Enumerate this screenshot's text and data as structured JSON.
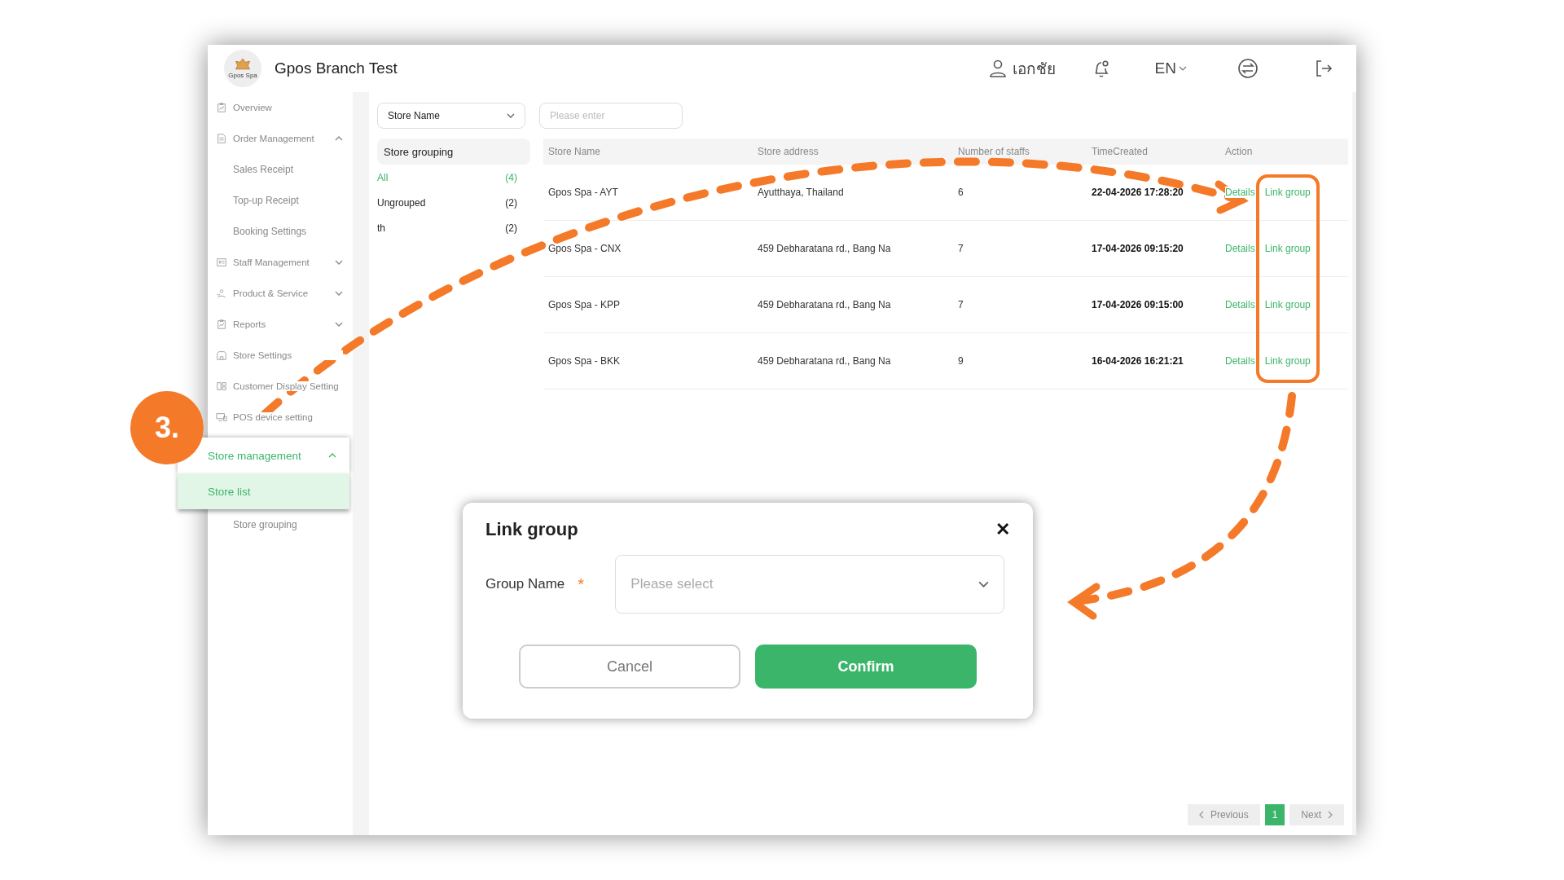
{
  "header": {
    "logo_text": "Gpos Spa",
    "title": "Gpos Branch Test",
    "user": "เอกชัย",
    "language": "EN"
  },
  "sidebar": {
    "items": [
      {
        "label": "Overview",
        "kind": "link",
        "selected": false
      },
      {
        "label": "Order Management",
        "kind": "group",
        "expanded": true,
        "selected": false,
        "children": [
          {
            "label": "Sales Receipt",
            "selected": false
          },
          {
            "label": "Top-up Receipt",
            "selected": false
          },
          {
            "label": "Booking Settings",
            "selected": false
          }
        ]
      },
      {
        "label": "Staff Management",
        "kind": "group",
        "expanded": false,
        "selected": false
      },
      {
        "label": "Product & Service",
        "kind": "group",
        "expanded": false,
        "selected": false
      },
      {
        "label": "Reports",
        "kind": "group",
        "expanded": false,
        "selected": false
      },
      {
        "label": "Store Settings",
        "kind": "link",
        "selected": false
      },
      {
        "label": "Customer Display Setting",
        "kind": "link",
        "selected": false
      },
      {
        "label": "POS device setting",
        "kind": "link",
        "selected": false
      },
      {
        "label": "Store management",
        "kind": "group",
        "expanded": true,
        "selected": true,
        "children": [
          {
            "label": "Store list",
            "selected": true
          },
          {
            "label": "Store grouping",
            "selected": false
          }
        ]
      }
    ]
  },
  "filters": {
    "field": "Store Name",
    "search_placeholder": "Please enter"
  },
  "store_grouping": {
    "title": "Store grouping",
    "items": [
      {
        "label": "All",
        "count": "(4)",
        "selected": true
      },
      {
        "label": "Ungrouped",
        "count": "(2)",
        "selected": false
      },
      {
        "label": "th",
        "count": "(2)",
        "selected": false
      }
    ]
  },
  "table": {
    "columns": [
      "Store Name",
      "Store address",
      "Number of staffs",
      "TimeCreated",
      "Action"
    ],
    "rows": [
      {
        "name": "Gpos Spa - AYT",
        "address": "Ayutthaya, Thailand",
        "staffs": "6",
        "created": "22-04-2026 17:28:20",
        "actions": [
          "Details",
          "Link group"
        ]
      },
      {
        "name": "Gpos Spa - CNX",
        "address": "459 Debharatana rd., Bang Na",
        "staffs": "7",
        "created": "17-04-2026 09:15:20",
        "actions": [
          "Details",
          "Link group"
        ]
      },
      {
        "name": "Gpos Spa - KPP",
        "address": "459 Debharatana rd., Bang Na",
        "staffs": "7",
        "created": "17-04-2026 09:15:00",
        "actions": [
          "Details",
          "Link group"
        ]
      },
      {
        "name": "Gpos Spa - BKK",
        "address": "459 Debharatana rd., Bang Na",
        "staffs": "9",
        "created": "16-04-2026 16:21:21",
        "actions": [
          "Details",
          "Link group"
        ]
      }
    ]
  },
  "pagination": {
    "previous": {
      "label": "Previous",
      "disabled": true
    },
    "pages": [
      {
        "label": "1",
        "selected": true
      }
    ],
    "next": {
      "label": "Next",
      "disabled": true
    }
  },
  "dialog": {
    "title": "Link group",
    "close": "✕",
    "field_label": "Group Name",
    "required_mark": "*",
    "placeholder": "Please select",
    "buttons": [
      {
        "label": "Cancel",
        "kind": "secondary"
      },
      {
        "label": "Confirm",
        "kind": "primary"
      }
    ]
  },
  "annotation": {
    "step": "3."
  }
}
